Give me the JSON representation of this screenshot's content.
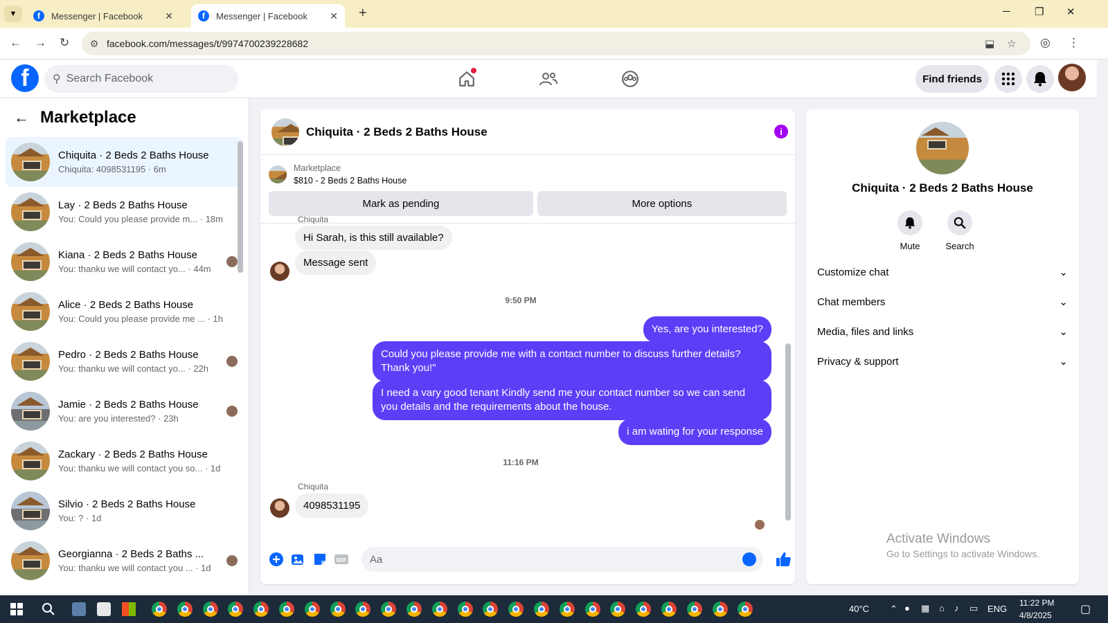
{
  "browser": {
    "tabs": [
      {
        "title": "Messenger | Facebook",
        "active": false
      },
      {
        "title": "Messenger | Facebook",
        "active": true
      }
    ],
    "url": "facebook.com/messages/t/9974700239228682"
  },
  "header": {
    "search_placeholder": "Search Facebook",
    "find_friends_label": "Find friends"
  },
  "sidebar": {
    "title": "Marketplace",
    "conversations": [
      {
        "name": "Chiquita · 2 Beds 2 Baths House",
        "preview": "Chiquita: 4098531195 · 6m",
        "active": true,
        "house": "brown",
        "seen": false
      },
      {
        "name": "Lay · 2 Beds 2 Baths House",
        "preview": "You: Could you please provide m... · 18m",
        "active": false,
        "house": "brown",
        "seen": false
      },
      {
        "name": "Kiana · 2 Beds 2 Baths House",
        "preview": "You: thanku we will contact yo... · 44m",
        "active": false,
        "house": "brown",
        "seen": true
      },
      {
        "name": "Alice · 2 Beds 2 Baths House",
        "preview": "You: Could you please provide me ... · 1h",
        "active": false,
        "house": "brown",
        "seen": false
      },
      {
        "name": "Pedro · 2 Beds 2 Baths House",
        "preview": "You: thanku we will contact yo... · 22h",
        "active": false,
        "house": "brown",
        "seen": true
      },
      {
        "name": "Jamie · 2 Beds 2 Baths House",
        "preview": "You: are you interested? · 23h",
        "active": false,
        "house": "gray",
        "seen": true
      },
      {
        "name": "Zackary · 2 Beds 2 Baths House",
        "preview": "You: thanku we will contact you so... · 1d",
        "active": false,
        "house": "brown",
        "seen": false
      },
      {
        "name": "Silvio · 2 Beds 2 Baths House",
        "preview": "You: ? · 1d",
        "active": false,
        "house": "gray",
        "seen": false
      },
      {
        "name": "Georgianna · 2 Beds 2 Baths ...",
        "preview": "You: thanku we will contact you ... · 1d",
        "active": false,
        "house": "brown",
        "seen": true
      }
    ]
  },
  "chat": {
    "title": "Chiquita · 2 Beds 2 Baths House",
    "marketplace_label": "Marketplace",
    "listing": "$810 - 2 Beds 2 Baths House",
    "mark_pending_label": "Mark as pending",
    "more_options_label": "More options",
    "sender_name_top": "Chiquita",
    "msg_in_1": "Hi Sarah, is this still available?",
    "msg_in_2": "Message sent",
    "time_1": "9:50 PM",
    "msg_out_1": "Yes, are you interested?",
    "msg_out_2": "Could you please provide me with a contact number to discuss further details? Thank you!\"",
    "msg_out_3": "I need a vary good tenant Kindly send me your contact number so we can send you details and the requirements about the house.",
    "msg_out_4": "i am wating for your response",
    "time_2": "11:16 PM",
    "sender_name_bottom": "Chiquita",
    "msg_in_3": "4098531195",
    "composer_placeholder": "Aa"
  },
  "right_panel": {
    "name": "Chiquita · 2 Beds 2 Baths House",
    "mute_label": "Mute",
    "search_label": "Search",
    "sections": [
      "Customize chat",
      "Chat members",
      "Media, files and links",
      "Privacy & support"
    ],
    "watermark_1": "Activate Windows",
    "watermark_2": "Go to Settings to activate Windows."
  },
  "taskbar": {
    "weather": "40°C",
    "lang": "ENG",
    "time": "11:22 PM",
    "date": "4/8/2025"
  },
  "colors": {
    "fb_blue": "#0866ff",
    "bubble_out": "#5b3ff7",
    "active_row": "#ebf5ff",
    "info_purple": "#a100f2"
  }
}
